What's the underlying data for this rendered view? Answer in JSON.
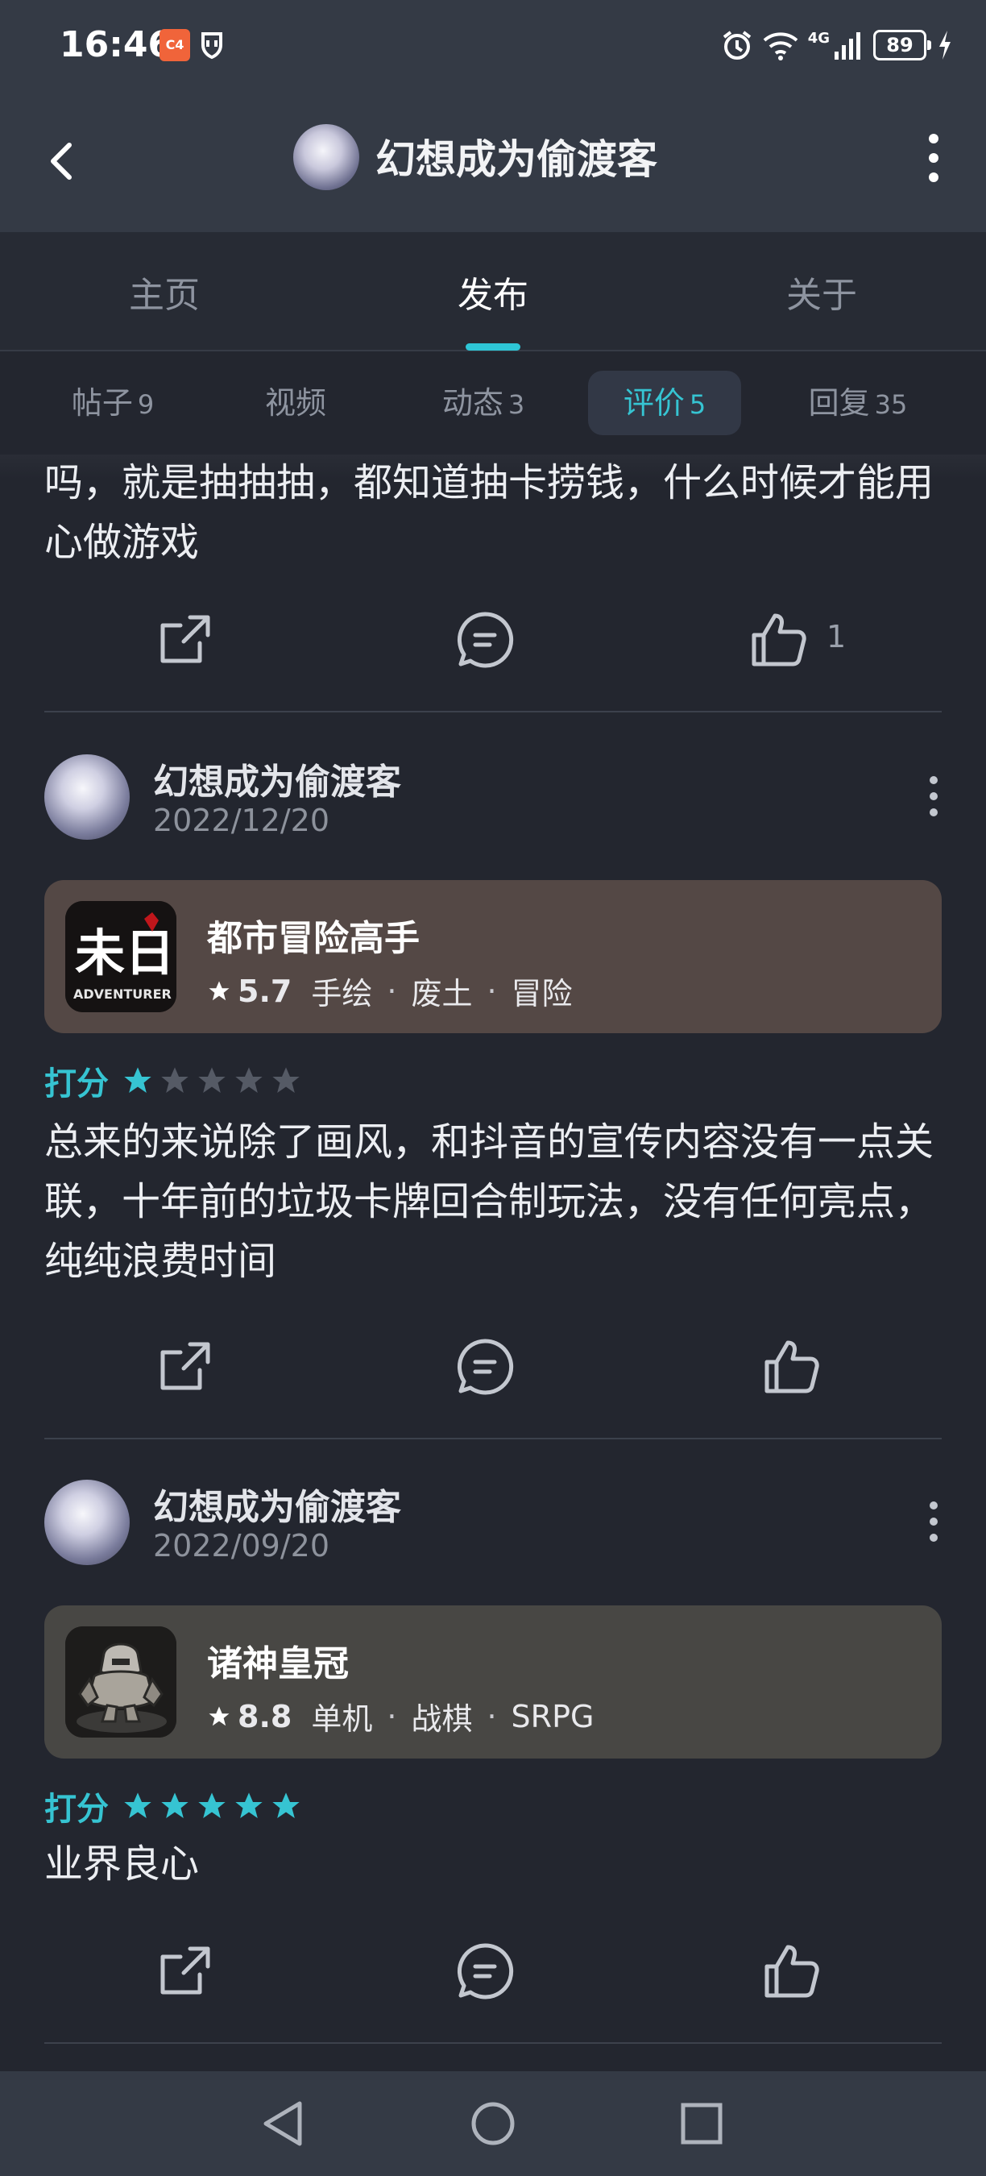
{
  "status_bar": {
    "time": "16:46",
    "app_icon_text": "C4",
    "network": "4G",
    "battery": "89"
  },
  "header": {
    "title": "幻想成为偷渡客"
  },
  "main_tabs": [
    {
      "label": "主页"
    },
    {
      "label": "发布"
    },
    {
      "label": "关于"
    }
  ],
  "sub_tabs": [
    {
      "label": "帖子",
      "count": "9"
    },
    {
      "label": "视频",
      "count": ""
    },
    {
      "label": "动态",
      "count": "3"
    },
    {
      "label": "评价",
      "count": "5"
    },
    {
      "label": "回复",
      "count": "35"
    }
  ],
  "review0": {
    "text": "吗，就是抽抽抽，都知道抽卡捞钱，什么时候才能用心做游戏",
    "likes": "1"
  },
  "review1": {
    "username": "幻想成为偷渡客",
    "date": "2022/12/20",
    "game": {
      "name": "都市冒险高手",
      "score": "5.7",
      "tags": [
        "手绘",
        "废土",
        "冒险"
      ],
      "icon_text": "ADVENTURER",
      "icon_glyph": "未日"
    },
    "rating_label": "打分",
    "rating": 1,
    "text": "总来的来说除了画风，和抖音的宣传内容没有一点关联，十年前的垃圾卡牌回合制玩法，没有任何亮点，纯纯浪费时间"
  },
  "review2": {
    "username": "幻想成为偷渡客",
    "date": "2022/09/20",
    "game": {
      "name": "诸神皇冠",
      "score": "8.8",
      "tags": [
        "单机",
        "战棋",
        "SRPG"
      ]
    },
    "rating_label": "打分",
    "rating": 5,
    "text": "业界良心"
  },
  "colors": {
    "accent": "#36c4d2",
    "card1": "#544845",
    "card2": "#484744",
    "background": "#23262f"
  }
}
